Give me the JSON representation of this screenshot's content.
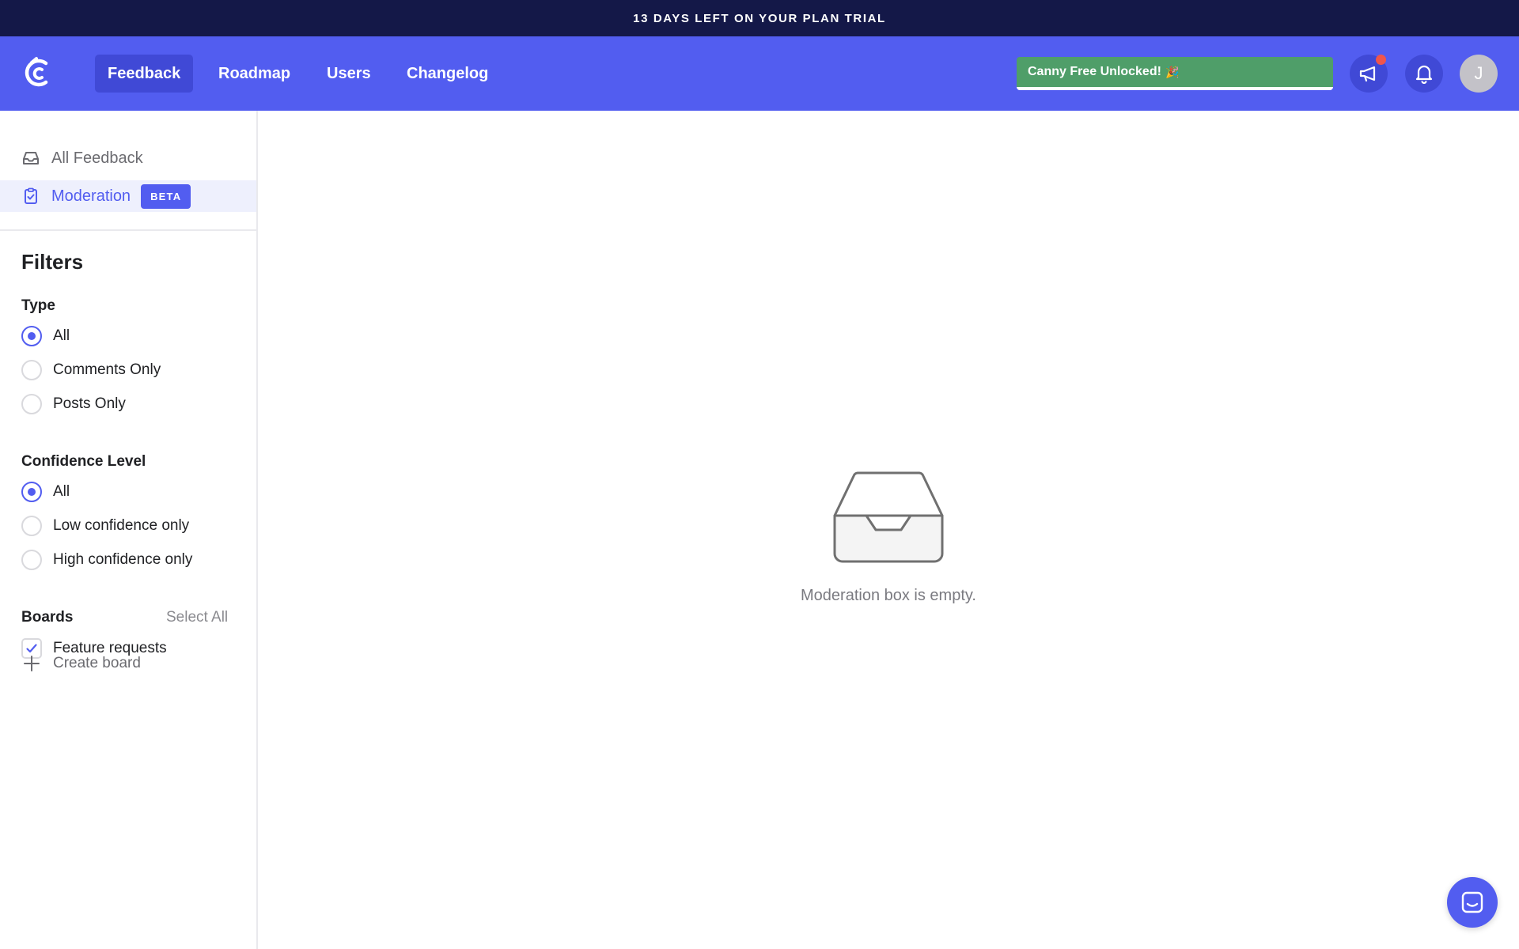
{
  "banner": {
    "text": "13 DAYS LEFT ON YOUR PLAN TRIAL"
  },
  "header": {
    "nav": [
      {
        "label": "Feedback",
        "active": true
      },
      {
        "label": "Roadmap",
        "active": false
      },
      {
        "label": "Users",
        "active": false
      },
      {
        "label": "Changelog",
        "active": false
      }
    ],
    "promo_label": "Canny Free Unlocked!",
    "avatar_initial": "J"
  },
  "sidebar": {
    "items": [
      {
        "label": "All Feedback",
        "icon": "inbox-icon"
      },
      {
        "label": "Moderation",
        "icon": "clipboard-check-icon",
        "badge": "BETA",
        "active": true
      }
    ],
    "filters_title": "Filters",
    "type": {
      "title": "Type",
      "options": [
        "All",
        "Comments Only",
        "Posts Only"
      ],
      "selected": "All"
    },
    "confidence": {
      "title": "Confidence Level",
      "options": [
        "All",
        "Low confidence only",
        "High confidence only"
      ],
      "selected": "All"
    },
    "boards": {
      "title": "Boards",
      "select_all": "Select All",
      "items": [
        {
          "label": "Feature requests",
          "checked": true
        }
      ],
      "create_label": "Create board"
    }
  },
  "main": {
    "empty_text": "Moderation box is empty."
  },
  "colors": {
    "brand": "#525df0",
    "banner": "#141848",
    "promo": "#4f9e69",
    "notification": "#f0554b"
  }
}
